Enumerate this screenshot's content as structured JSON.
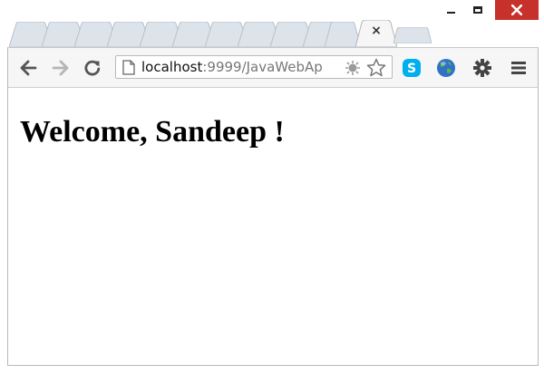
{
  "window": {
    "controls": {
      "minimize": "minimize",
      "maximize": "maximize",
      "close": "close"
    }
  },
  "tabs": {
    "inactive_count": 11,
    "active_close_glyph": "×"
  },
  "toolbar": {
    "back_icon": "back-arrow-icon",
    "forward_icon": "forward-arrow-icon",
    "reload_icon": "reload-icon",
    "address": {
      "host": "localhost",
      "path": ":9999/JavaWebAp"
    },
    "extensions": [
      "skype-icon",
      "globe-icon"
    ],
    "settings_icon": "wrench-gear-icon",
    "menu_icon": "hamburger-menu-icon",
    "colors": {
      "close_button": "#c7312b",
      "skype": "#00aff0",
      "globe": "#2f72c8"
    }
  },
  "page": {
    "heading": "Welcome, Sandeep !"
  }
}
